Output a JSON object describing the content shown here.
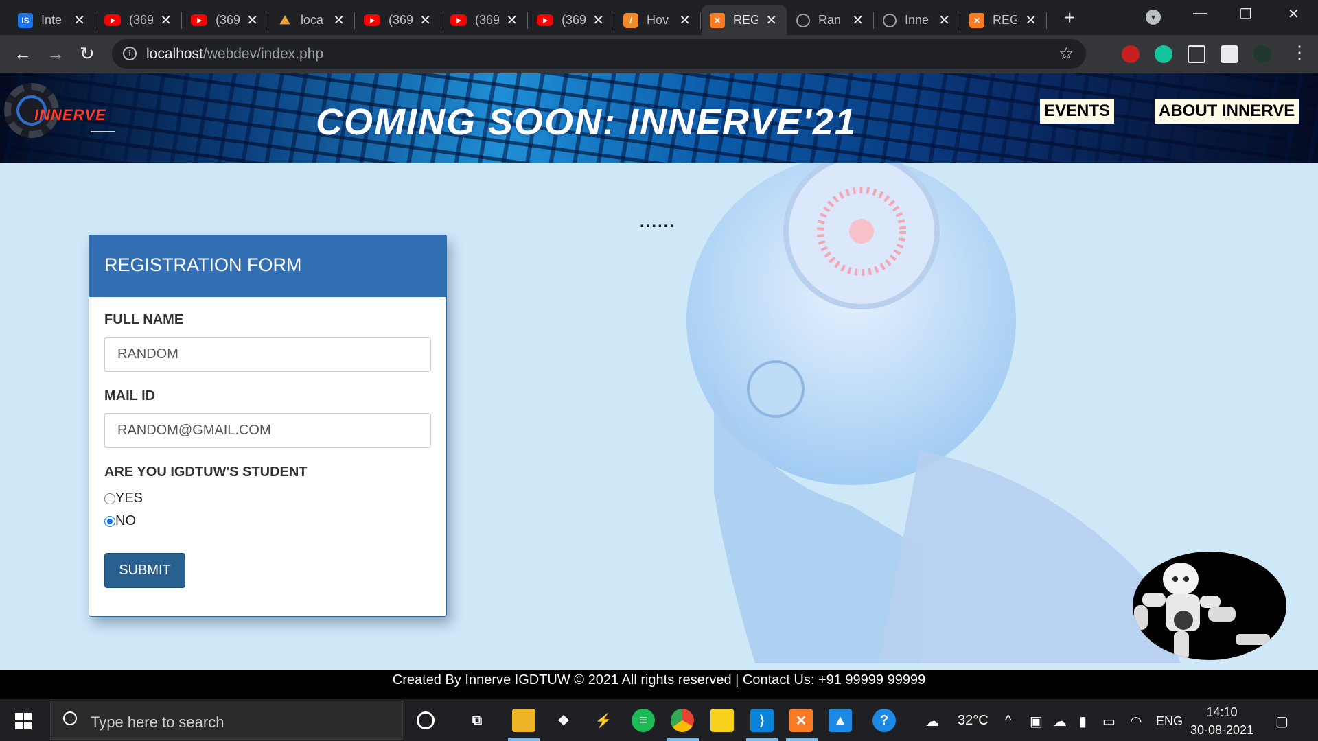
{
  "browser": {
    "tabs": [
      {
        "title": "Inte",
        "icon": "is-logo-icon",
        "active": false
      },
      {
        "title": "(369",
        "icon": "youtube-icon",
        "active": false
      },
      {
        "title": "(369",
        "icon": "youtube-icon",
        "active": false
      },
      {
        "title": "loca",
        "icon": "pma-icon",
        "active": false
      },
      {
        "title": "(369",
        "icon": "youtube-icon",
        "active": false
      },
      {
        "title": "(369",
        "icon": "youtube-icon",
        "active": false
      },
      {
        "title": "(369",
        "icon": "youtube-icon",
        "active": false
      },
      {
        "title": "Hov",
        "icon": "hover-app-icon",
        "active": false
      },
      {
        "title": "REG",
        "icon": "xampp-icon",
        "active": true
      },
      {
        "title": "Ran",
        "icon": "globe-icon",
        "active": false
      },
      {
        "title": "Inne",
        "icon": "globe-icon",
        "active": false
      },
      {
        "title": "REG",
        "icon": "xampp-icon",
        "active": false
      }
    ],
    "url_host": "localhost",
    "url_path": "/webdev/index.php"
  },
  "site": {
    "logo_text": "INNERVE",
    "banner_title": "COMING SOON: INNERVE'21",
    "nav": {
      "events": "EVENTS",
      "about": "ABOUT INNERVE"
    },
    "loading_dots": "......"
  },
  "form": {
    "heading": "REGISTRATION FORM",
    "fullname_label": "FULL NAME",
    "fullname_value": "RANDOM",
    "mail_label": "MAIL ID",
    "mail_value": "RANDOM@GMAIL.COM",
    "student_question": "ARE YOU IGDTUW'S STUDENT",
    "option_yes": "YES",
    "option_no": "NO",
    "selected": "NO",
    "submit_label": "SUBMIT"
  },
  "footer": {
    "text": "Created By Innerve IGDTUW © 2021 All rights reserved | Contact Us: +91 99999 99999"
  },
  "taskbar": {
    "search_placeholder": "Type here to search",
    "weather": "32°C",
    "language": "ENG",
    "time": "14:10",
    "date": "30-08-2021"
  },
  "colors": {
    "card_header": "#3370b3",
    "submit_button": "#286090",
    "page_background": "#cfe8f8"
  }
}
